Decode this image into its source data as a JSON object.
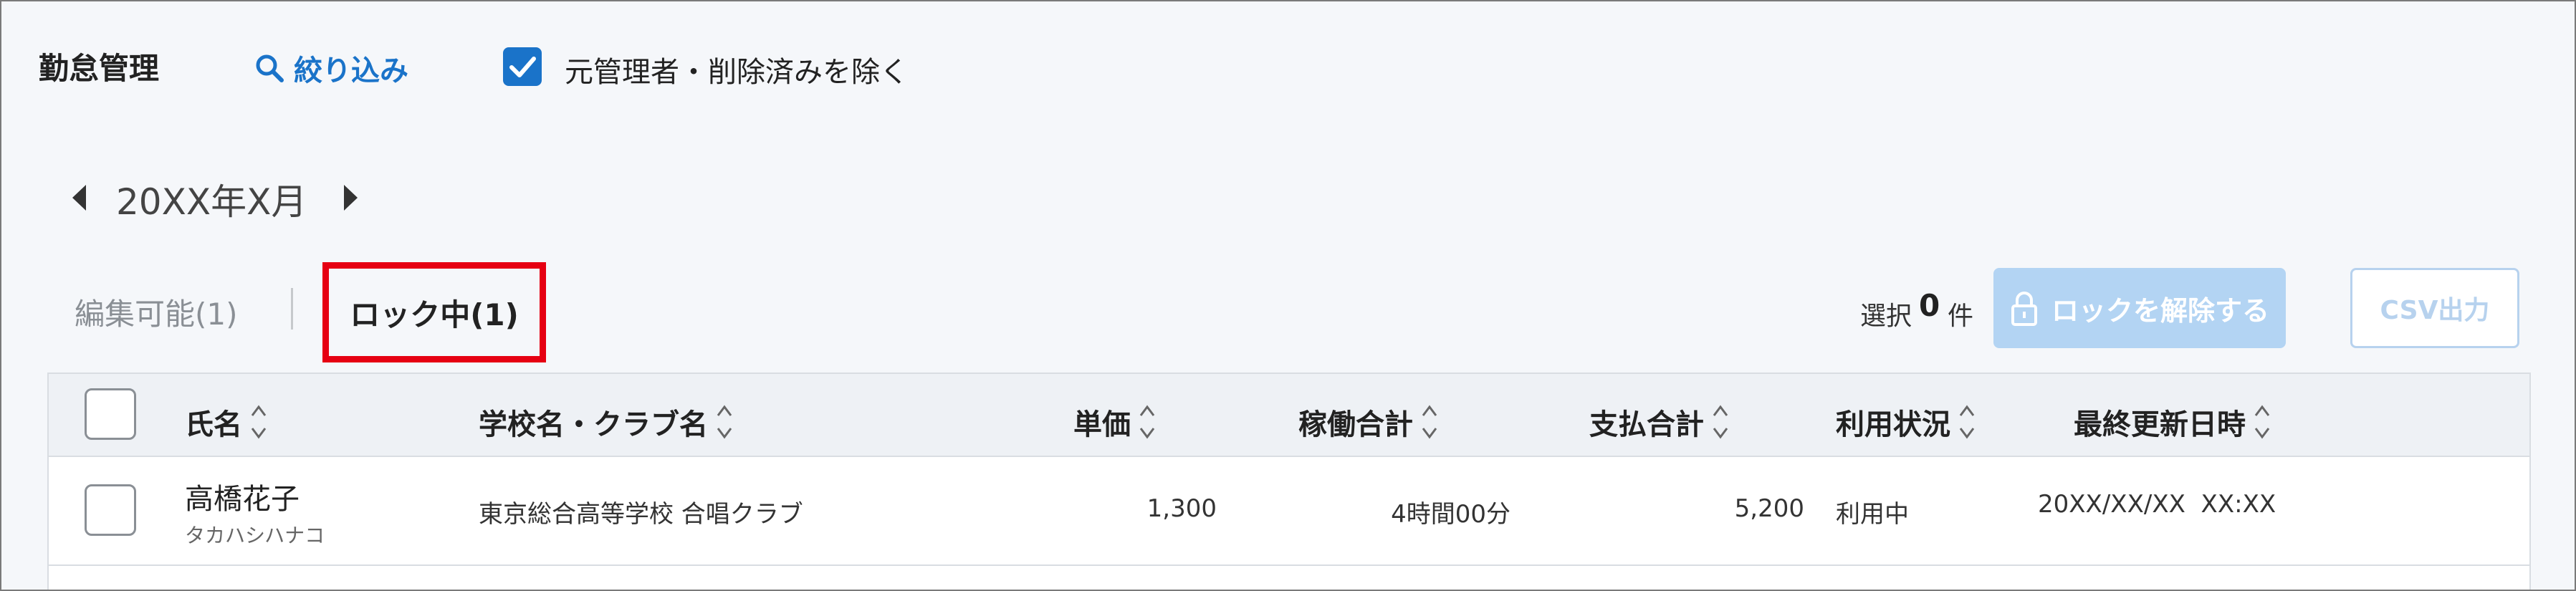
{
  "header": {
    "title": "勤怠管理",
    "filter_label": "絞り込み",
    "exclude_checkbox_label": "元管理者・削除済みを除く",
    "exclude_checked": true
  },
  "month": {
    "label": "20XX年X月"
  },
  "tabs": [
    {
      "label": "編集可能(1)",
      "active": false
    },
    {
      "label": "ロック中(1)",
      "active": true
    }
  ],
  "selection": {
    "prefix": "選択",
    "count": "0",
    "suffix": "件"
  },
  "buttons": {
    "unlock": "ロックを解除する",
    "csv": "CSV出力"
  },
  "table": {
    "columns": [
      "氏名",
      "学校名・クラブ名",
      "単価",
      "稼働合計",
      "支払合計",
      "利用状況",
      "最終更新日時"
    ],
    "rows": [
      {
        "name": "高橋花子",
        "kana": "タカハシハナコ",
        "school": "東京総合高等学校 合唱クラブ",
        "unit_price": "1,300",
        "work_total": "4時間00分",
        "pay_total": "5,200",
        "status": "利用中",
        "updated": "20XX/XX/XX  XX:XX"
      }
    ]
  },
  "colors": {
    "accent": "#1a73c9",
    "highlight_border": "#e60012",
    "disabled_button": "#b3d4f3"
  }
}
